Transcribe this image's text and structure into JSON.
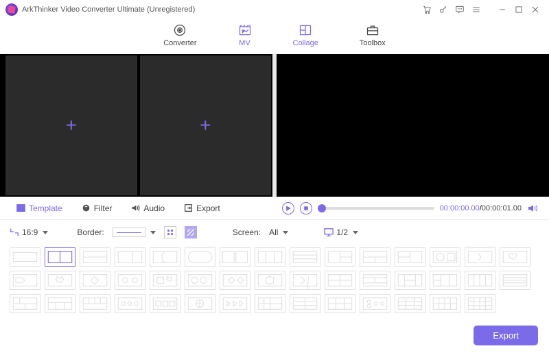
{
  "title": "ArkThinker Video Converter Ultimate (Unregistered)",
  "nav": {
    "converter": "Converter",
    "mv": "MV",
    "collage": "Collage",
    "toolbox": "Toolbox"
  },
  "tabs": {
    "template": "Template",
    "filter": "Filter",
    "audio": "Audio",
    "export": "Export"
  },
  "playback": {
    "current": "00:00:00.00",
    "total": "00:00:01.00"
  },
  "options": {
    "ratio": "16:9",
    "border_label": "Border:",
    "screen_label": "Screen:",
    "screen_value": "All",
    "pages": "1/2"
  },
  "export_button": "Export"
}
